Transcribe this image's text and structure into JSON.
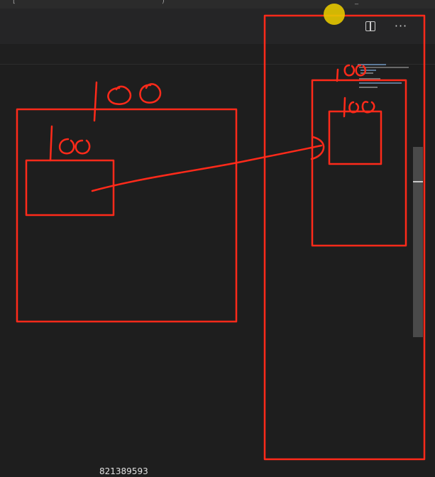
{
  "titlebar": {
    "partial_text": "[",
    "partial_text_end": ")",
    "right_text": "_"
  },
  "toolbar": {
    "split_icon": "split-editor-icon",
    "more_label": "···",
    "more_icon": "more-actions-icon"
  },
  "caption": {
    "text": "821389593"
  },
  "colors": {
    "annotation": "#ff2a1a",
    "cursor_highlight": "#e6c800",
    "editor_bg": "#1e1e1e"
  }
}
